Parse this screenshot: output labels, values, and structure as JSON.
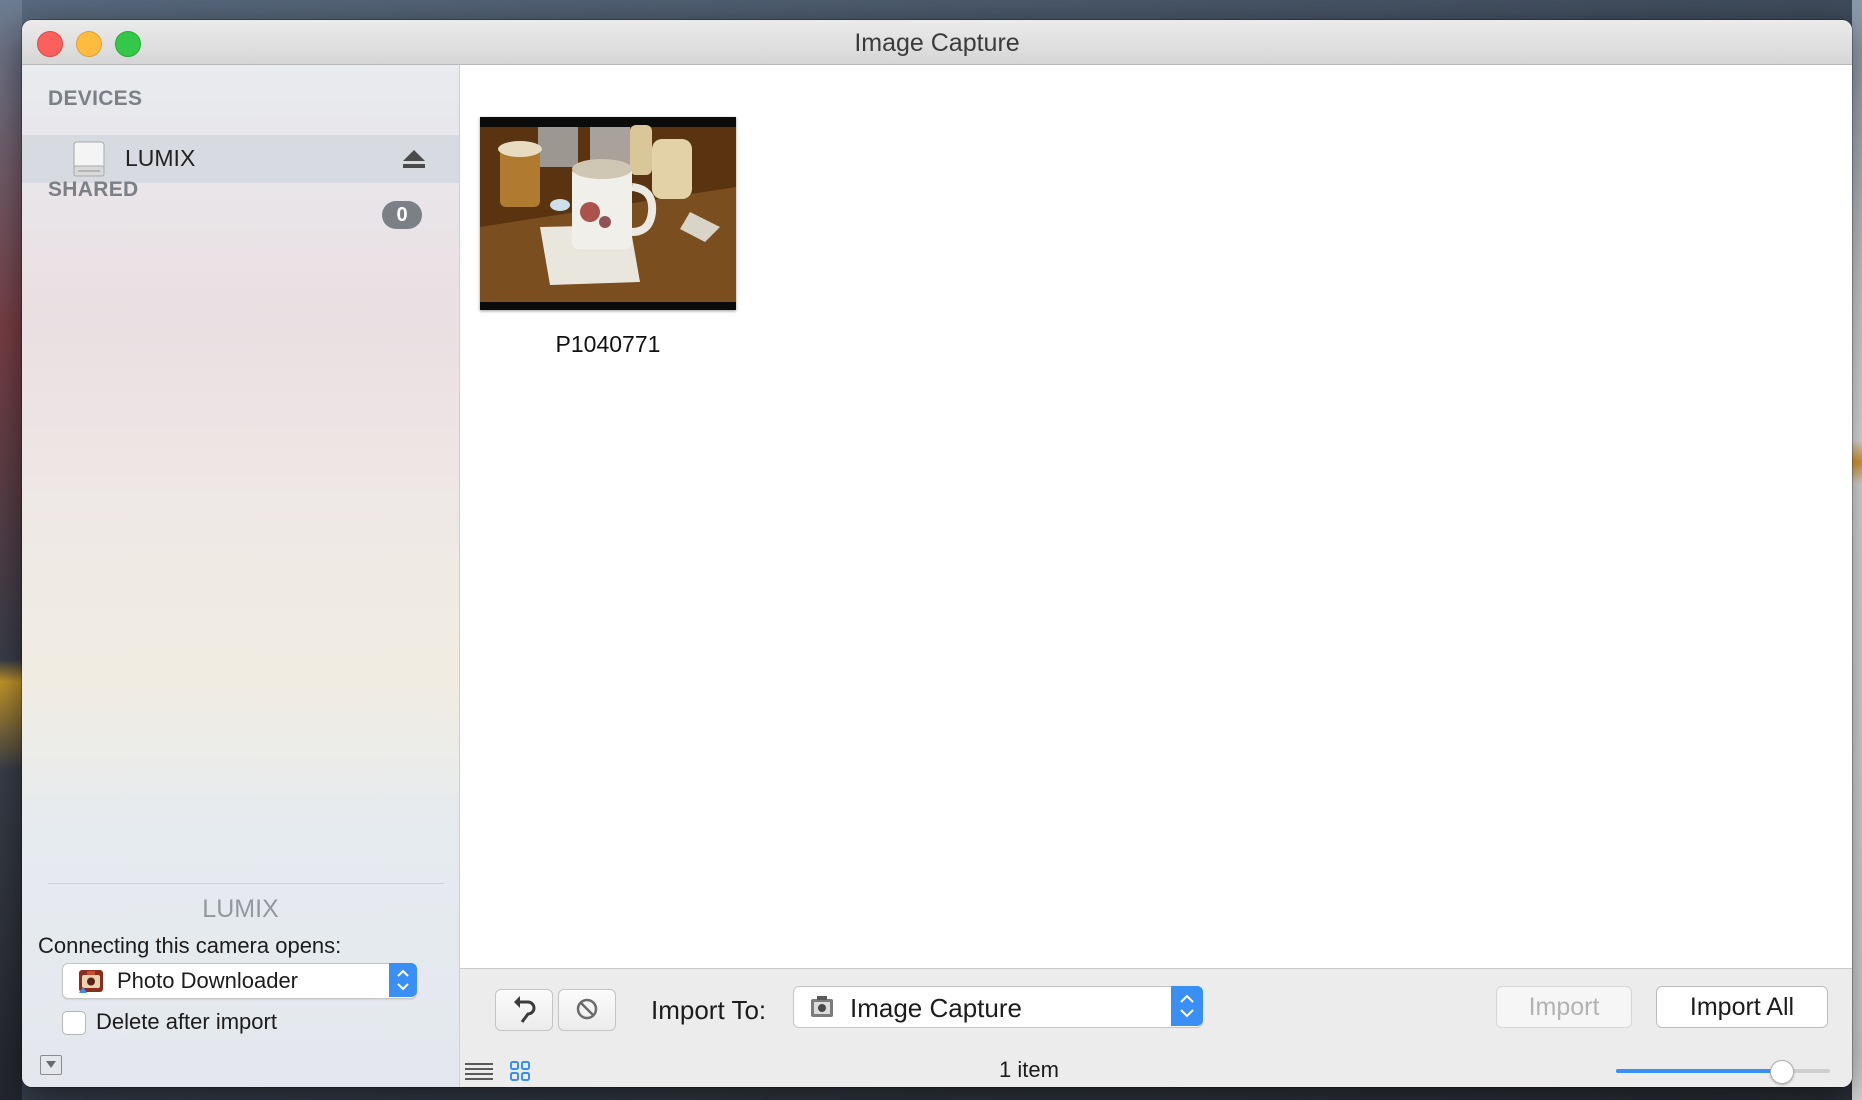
{
  "window": {
    "title": "Image Capture"
  },
  "sidebar": {
    "devices_heading": "DEVICES",
    "device": {
      "name": "LUMIX",
      "icon": "drive-icon",
      "eject_icon": "eject-icon"
    },
    "shared_heading": "SHARED",
    "shared_count": "0",
    "selected_device_name": "LUMIX",
    "opens_label": "Connecting this camera opens:",
    "opens_app": {
      "label": "Photo Downloader",
      "icon": "photo-downloader-icon"
    },
    "delete_after_import": {
      "label": "Delete after import",
      "checked": false
    }
  },
  "content": {
    "items": [
      {
        "name": "P1040771",
        "thumbnail": "coffee-mug-photo"
      }
    ]
  },
  "toolbar": {
    "rotate_icon": "rotate-left-icon",
    "delete_icon": "no-entry-icon",
    "import_to_label": "Import To:",
    "import_to_value": "Image Capture",
    "import_button": "Import",
    "import_all_button": "Import All"
  },
  "status": {
    "item_count": "1 item",
    "zoom_level": 0.77
  },
  "colors": {
    "accent": "#3a8ff5",
    "sidebar_selection": "#d7dbe1"
  }
}
